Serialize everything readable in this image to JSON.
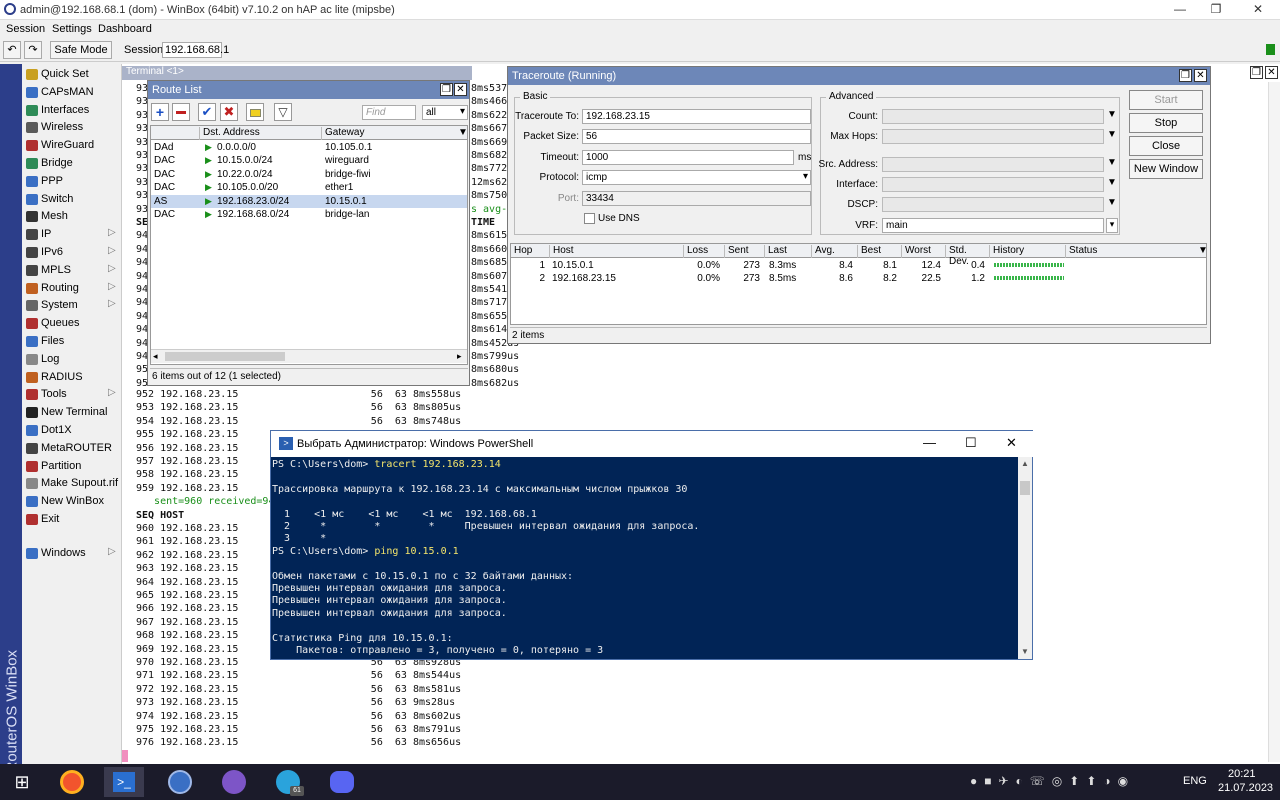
{
  "window": {
    "title": "admin@192.168.68.1 (dom) - WinBox (64bit) v7.10.2 on hAP ac lite (mipsbe)"
  },
  "menu": [
    "Session",
    "Settings",
    "Dashboard"
  ],
  "toolbar": {
    "undo": "↶",
    "redo": "↷",
    "safe_mode": "Safe Mode",
    "session_label": "Session:",
    "session_value": "192.168.68.1"
  },
  "brand": "RouterOS WinBox",
  "sidebar": [
    {
      "label": "Quick Set",
      "icon": "quickset-icon",
      "color": "#c9a020",
      "arrow": false
    },
    {
      "label": "CAPsMAN",
      "icon": "capsman-icon",
      "color": "#3a6fc4",
      "arrow": false
    },
    {
      "label": "Interfaces",
      "icon": "interfaces-icon",
      "color": "#2e8b57",
      "arrow": false
    },
    {
      "label": "Wireless",
      "icon": "wireless-icon",
      "color": "#5a5a5a",
      "arrow": false
    },
    {
      "label": "WireGuard",
      "icon": "wireguard-icon",
      "color": "#b03030",
      "arrow": false
    },
    {
      "label": "Bridge",
      "icon": "bridge-icon",
      "color": "#2e8b57",
      "arrow": false
    },
    {
      "label": "PPP",
      "icon": "ppp-icon",
      "color": "#3a6fc4",
      "arrow": false
    },
    {
      "label": "Switch",
      "icon": "switch-icon",
      "color": "#3a6fc4",
      "arrow": false
    },
    {
      "label": "Mesh",
      "icon": "mesh-icon",
      "color": "#333333",
      "arrow": false
    },
    {
      "label": "IP",
      "icon": "ip-icon",
      "color": "#444444",
      "arrow": true
    },
    {
      "label": "IPv6",
      "icon": "ipv6-icon",
      "color": "#444444",
      "arrow": true
    },
    {
      "label": "MPLS",
      "icon": "mpls-icon",
      "color": "#444444",
      "arrow": true
    },
    {
      "label": "Routing",
      "icon": "routing-icon",
      "color": "#c06020",
      "arrow": true
    },
    {
      "label": "System",
      "icon": "system-icon",
      "color": "#666666",
      "arrow": true
    },
    {
      "label": "Queues",
      "icon": "queues-icon",
      "color": "#b03030",
      "arrow": false
    },
    {
      "label": "Files",
      "icon": "files-icon",
      "color": "#3a6fc4",
      "arrow": false
    },
    {
      "label": "Log",
      "icon": "log-icon",
      "color": "#888888",
      "arrow": false
    },
    {
      "label": "RADIUS",
      "icon": "radius-icon",
      "color": "#c06020",
      "arrow": false
    },
    {
      "label": "Tools",
      "icon": "tools-icon",
      "color": "#b03030",
      "arrow": true
    },
    {
      "label": "New Terminal",
      "icon": "terminal-icon",
      "color": "#222222",
      "arrow": false
    },
    {
      "label": "Dot1X",
      "icon": "dot1x-icon",
      "color": "#3a6fc4",
      "arrow": false
    },
    {
      "label": "MetaROUTER",
      "icon": "metarouter-icon",
      "color": "#444444",
      "arrow": false
    },
    {
      "label": "Partition",
      "icon": "partition-icon",
      "color": "#b03030",
      "arrow": false
    },
    {
      "label": "Make Supout.rif",
      "icon": "supout-icon",
      "color": "#888888",
      "arrow": false
    },
    {
      "label": "New WinBox",
      "icon": "winbox-icon",
      "color": "#3a6fc4",
      "arrow": false
    },
    {
      "label": "Exit",
      "icon": "exit-icon",
      "color": "#b03030",
      "arrow": false
    },
    {
      "label": "Windows",
      "icon": "windows-icon",
      "color": "#3a6fc4",
      "arrow": true
    }
  ],
  "terminal": {
    "tab": "Terminal <1>",
    "lines": [
      "93",
      "93",
      "93",
      "93",
      "93",
      "93",
      "93",
      "93",
      "93",
      "93",
      "SE",
      "94",
      "94",
      "94",
      "94",
      "94",
      "94",
      "94",
      "94",
      "94",
      "94",
      "95",
      "95"
    ],
    "lines2": [
      "952 192.168.23.15                      56  63 8ms558us",
      "953 192.168.23.15                      56  63 8ms805us",
      "954 192.168.23.15                      56  63 8ms748us",
      "955 192.168.23.15",
      "956 192.168.23.15",
      "957 192.168.23.15",
      "958 192.168.23.15",
      "959 192.168.23.15",
      "   sent=960 received=94",
      "SEQ HOST",
      "960 192.168.23.15",
      "961 192.168.23.15",
      "962 192.168.23.15",
      "963 192.168.23.15",
      "964 192.168.23.15",
      "965 192.168.23.15",
      "966 192.168.23.15",
      "967 192.168.23.15",
      "968 192.168.23.15",
      "969 192.168.23.15",
      "970 192.168.23.15                      56  63 8ms928us",
      "971 192.168.23.15                      56  63 8ms544us",
      "972 192.168.23.15                      56  63 8ms581us",
      "973 192.168.23.15                      56  63 9ms28us",
      "974 192.168.23.15                      56  63 8ms602us",
      "975 192.168.23.15                      56  63 8ms791us",
      "976 192.168.23.15                      56  63 8ms656us"
    ],
    "right_col": [
      "8ms537",
      "8ms466",
      "8ms622",
      "8ms667",
      "8ms669",
      "8ms682",
      "8ms772",
      "12ms62",
      "8ms750",
      "s avg-",
      "TIME",
      "8ms615",
      "8ms660",
      "8ms685",
      "8ms607",
      "8ms541",
      "8ms717",
      "8ms655",
      "8ms614",
      "8ms452us",
      "8ms799us",
      "8ms680us",
      "8ms682us"
    ]
  },
  "route_list": {
    "title": "Route List",
    "find_placeholder": "Find",
    "filter": "all",
    "columns": [
      "",
      "Dst. Address",
      "Gateway"
    ],
    "rows": [
      {
        "flags": "DAd",
        "dst": "0.0.0.0/0",
        "gw": "10.105.0.1",
        "selected": false
      },
      {
        "flags": "DAC",
        "dst": "10.15.0.0/24",
        "gw": "wireguard",
        "selected": false
      },
      {
        "flags": "DAC",
        "dst": "10.22.0.0/24",
        "gw": "bridge-fiwi",
        "selected": false
      },
      {
        "flags": "DAC",
        "dst": "10.105.0.0/20",
        "gw": "ether1",
        "selected": false
      },
      {
        "flags": "AS",
        "dst": "192.168.23.0/24",
        "gw": "10.15.0.1",
        "selected": true
      },
      {
        "flags": "DAC",
        "dst": "192.168.68.0/24",
        "gw": "bridge-lan",
        "selected": false
      }
    ],
    "status": "6 items out of 12 (1 selected)"
  },
  "traceroute": {
    "title": "Traceroute (Running)",
    "basic_label": "Basic",
    "advanced_label": "Advanced",
    "fields": {
      "traceroute_to": {
        "label": "Traceroute To:",
        "value": "192.168.23.15"
      },
      "packet_size": {
        "label": "Packet Size:",
        "value": "56"
      },
      "timeout": {
        "label": "Timeout:",
        "value": "1000",
        "unit": "ms"
      },
      "protocol": {
        "label": "Protocol:",
        "value": "icmp"
      },
      "port": {
        "label": "Port:",
        "value": "33434"
      },
      "use_dns": {
        "label": "Use DNS",
        "checked": false
      }
    },
    "advanced": {
      "count": "Count:",
      "max_hops": "Max Hops:",
      "src_address": "Src. Address:",
      "interface": "Interface:",
      "dscp": "DSCP:",
      "vrf": "VRF:",
      "vrf_value": "main"
    },
    "buttons": {
      "start": "Start",
      "stop": "Stop",
      "close": "Close",
      "new_window": "New Window"
    },
    "columns": [
      "Hop",
      "Host",
      "Loss",
      "Sent",
      "Last",
      "Avg.",
      "Best",
      "Worst",
      "Std. Dev.",
      "History",
      "Status"
    ],
    "rows": [
      {
        "hop": "1",
        "host": "10.15.0.1",
        "loss": "0.0%",
        "sent": "273",
        "last": "8.3ms",
        "avg": "8.4",
        "best": "8.1",
        "worst": "12.4",
        "stdev": "0.4"
      },
      {
        "hop": "2",
        "host": "192.168.23.15",
        "loss": "0.0%",
        "sent": "273",
        "last": "8.5ms",
        "avg": "8.6",
        "best": "8.2",
        "worst": "22.5",
        "stdev": "1.2"
      }
    ],
    "status": "2 items"
  },
  "powershell": {
    "title": "Выбрать Администратор: Windows PowerShell",
    "lines": [
      {
        "text": "PS C:\\Users\\dom> ",
        "cmd": "tracert 192.168.23.14"
      },
      {
        "text": ""
      },
      {
        "text": "Трассировка маршрута к 192.168.23.14 с максимальным числом прыжков 30"
      },
      {
        "text": ""
      },
      {
        "text": "  1    <1 мс    <1 мс    <1 мс  192.168.68.1"
      },
      {
        "text": "  2     *        *        *     Превышен интервал ожидания для запроса."
      },
      {
        "text": "  3     *"
      },
      {
        "text": "PS C:\\Users\\dom> ",
        "cmd": "ping 10.15.0.1"
      },
      {
        "text": ""
      },
      {
        "text": "Обмен пакетами с 10.15.0.1 по с 32 байтами данных:"
      },
      {
        "text": "Превышен интервал ожидания для запроса."
      },
      {
        "text": "Превышен интервал ожидания для запроса."
      },
      {
        "text": "Превышен интервал ожидания для запроса."
      },
      {
        "text": ""
      },
      {
        "text": "Статистика Ping для 10.15.0.1:"
      },
      {
        "text": "    Пакетов: отправлено = 3, получено = 0, потеряно = 3"
      }
    ]
  },
  "taskbar": {
    "apps": [
      "windows-start-icon",
      "firefox-icon",
      "powershell-icon",
      "winbox-icon",
      "viber-icon",
      "telegram-icon",
      "discord-icon"
    ],
    "telegram_badge": "61",
    "lang": "ENG",
    "time": "20:21",
    "date": "21.07.2023"
  }
}
